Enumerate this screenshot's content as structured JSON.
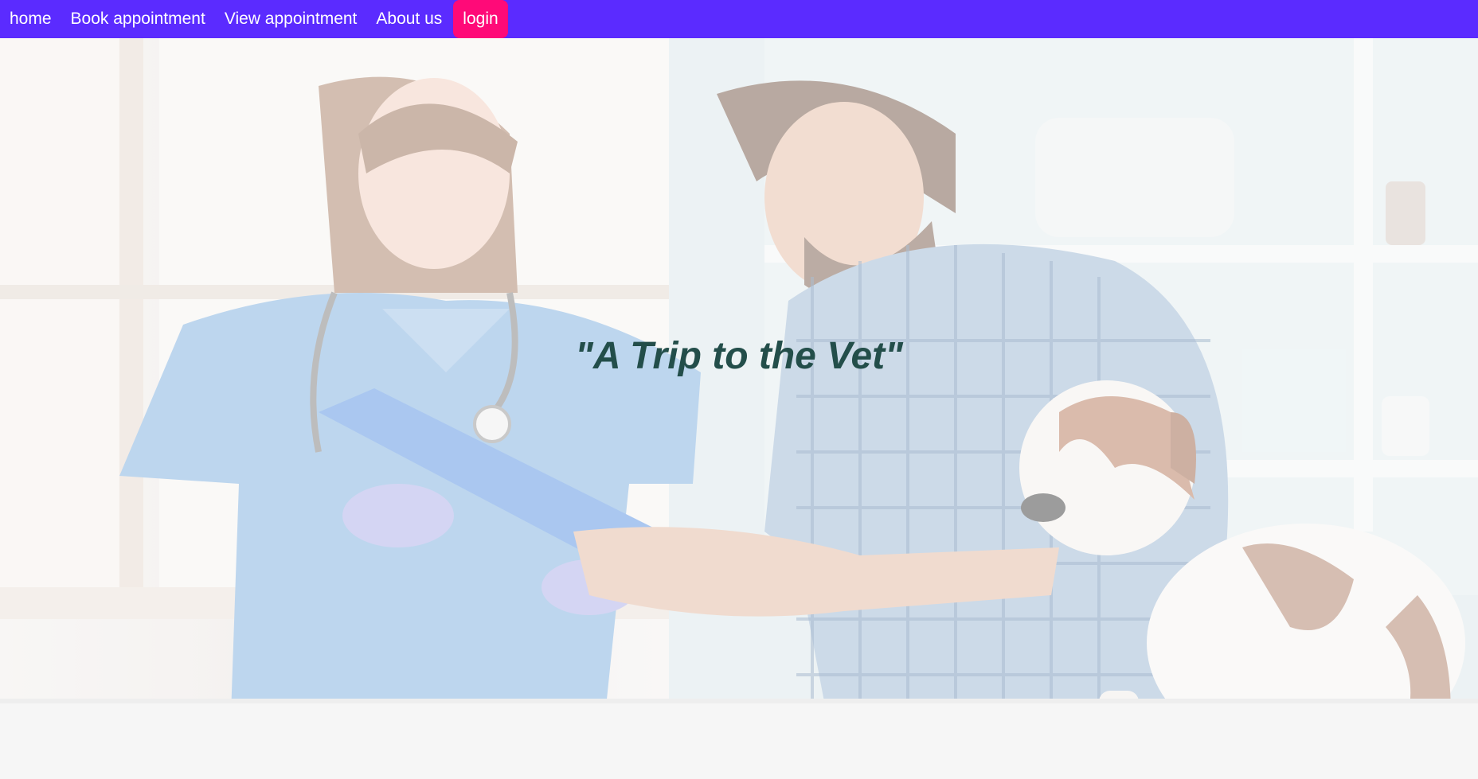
{
  "nav": {
    "items": [
      {
        "label": "home"
      },
      {
        "label": "Book appointment"
      },
      {
        "label": "View appointment"
      },
      {
        "label": "About us"
      }
    ],
    "login_label": "login"
  },
  "hero": {
    "title": "\"A Trip to the Vet\""
  },
  "colors": {
    "navbar": "#5b2bff",
    "login_button": "#ff0a78",
    "title": "#234e4a"
  }
}
